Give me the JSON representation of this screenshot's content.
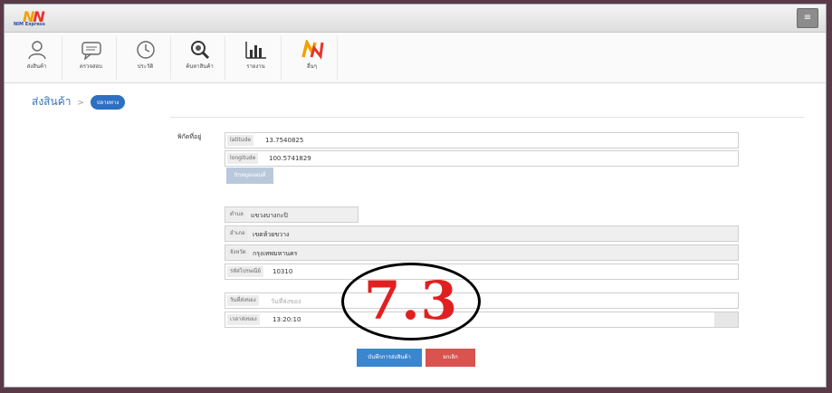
{
  "header": {
    "logo_text": "N",
    "logo_sub": "NIM Express",
    "menu_icon": "menu-icon"
  },
  "toolbar": {
    "items": [
      {
        "label": "ส่งสินค้า",
        "icon": "user-icon"
      },
      {
        "label": "ตรวจสอบ",
        "icon": "chat-icon"
      },
      {
        "label": "ประวัติ",
        "icon": "clock-icon"
      },
      {
        "label": "ค้นหาสินค้า",
        "icon": "search-icon"
      },
      {
        "label": "รายงาน",
        "icon": "bar-chart-icon"
      },
      {
        "label": "อื่นๆ",
        "icon": "nim-logo-icon"
      }
    ]
  },
  "breadcrumb": {
    "title": "ส่งสินค้า",
    "separator": ">",
    "badge": "ปลายทาง"
  },
  "form": {
    "location_label": "พิกัดที่อยู่",
    "latitude_caption": "latitude",
    "latitude_value": "13.7540825",
    "longitude_caption": "longitude",
    "longitude_value": "100.5741829",
    "map_button": "ปักหมุดแผนที่",
    "subdistrict_caption": "ตำบล",
    "subdistrict_value": "แขวงบางกะปิ",
    "district_caption": "อำเภอ",
    "district_value": "เขตห้วยขวาง",
    "province_caption": "จังหวัด",
    "province_value": "กรุงเทพมหานคร",
    "postcode_caption": "รหัสไปรษณีย์",
    "postcode_value": "10310",
    "date_caption": "วันที่ส่งของ",
    "date_placeholder": "วันที่ส่งของ",
    "time_caption": "เวลาส่งของ",
    "time_value": "13:20:10",
    "save_button": "บันทึกการส่งสินค้า",
    "cancel_button": "ยกเลิก"
  },
  "annotation": {
    "step_number": "7.3"
  }
}
